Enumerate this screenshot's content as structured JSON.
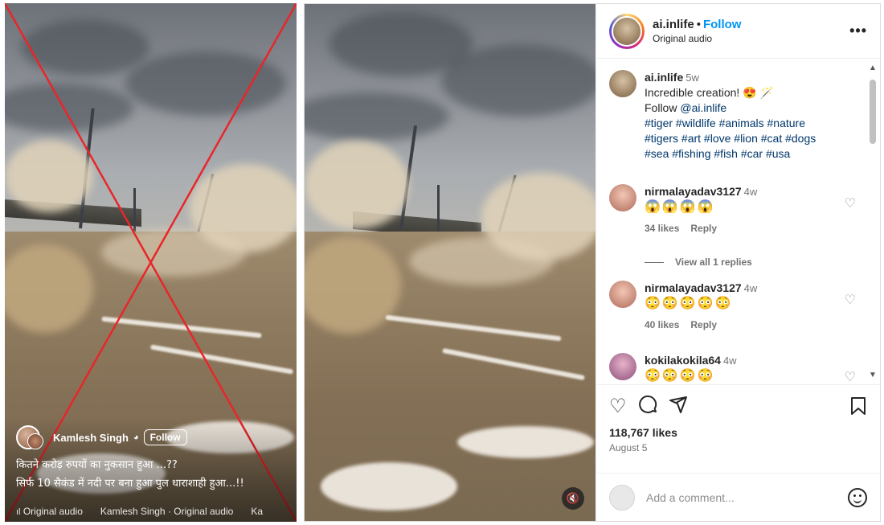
{
  "left_reel": {
    "author": "Kamlesh Singh",
    "globe_icon": "globe-icon",
    "follow_label": "Follow",
    "caption_line1": "कितने करोड़ रुपयों का नुकसान हुआ ...??",
    "caption_line2": "सिर्फ 10 सैकंड में नदी पर बना हुआ पुल धाराशाही हुआ...!!",
    "audio_left": "Original audio",
    "audio_right": "Kamlesh Singh · Original audio",
    "audio_cut": "Ka",
    "overlay_mark": "red-x",
    "overlay_color": "#e8262a"
  },
  "post": {
    "username": "ai.inlife",
    "dot": "•",
    "follow_label": "Follow",
    "audio_label": "Original audio",
    "more_icon": "•••",
    "caption": {
      "username": "ai.inlife",
      "time": "5w",
      "text": "Incredible creation! 😍 🪄",
      "follow_prefix": "Follow ",
      "mention": "@ai.inlife",
      "tags_line1": "#tiger #wildlife #animals #nature",
      "tags_line2": "#tigers #art #love #lion #cat #dogs",
      "tags_line3": "#sea #fishing #fish #car #usa"
    },
    "comments": [
      {
        "username": "nirmalayadav3127",
        "time": "4w",
        "emojis": "😱😱😱😱",
        "likes": "34 likes",
        "reply": "Reply"
      },
      {
        "username": "nirmalayadav3127",
        "time": "4w",
        "emojis": "😳😳😳😳😳",
        "likes": "40 likes",
        "reply": "Reply"
      },
      {
        "username": "kokilakokila64",
        "time": "4w",
        "emojis": "😳😳😳😳"
      }
    ],
    "view_replies": "View all 1 replies",
    "likes": "118,767 likes",
    "date": "August 5",
    "add_comment_placeholder": "Add a comment...",
    "mute_icon": "speaker-muted-icon",
    "accent_color": "#0095f6"
  }
}
